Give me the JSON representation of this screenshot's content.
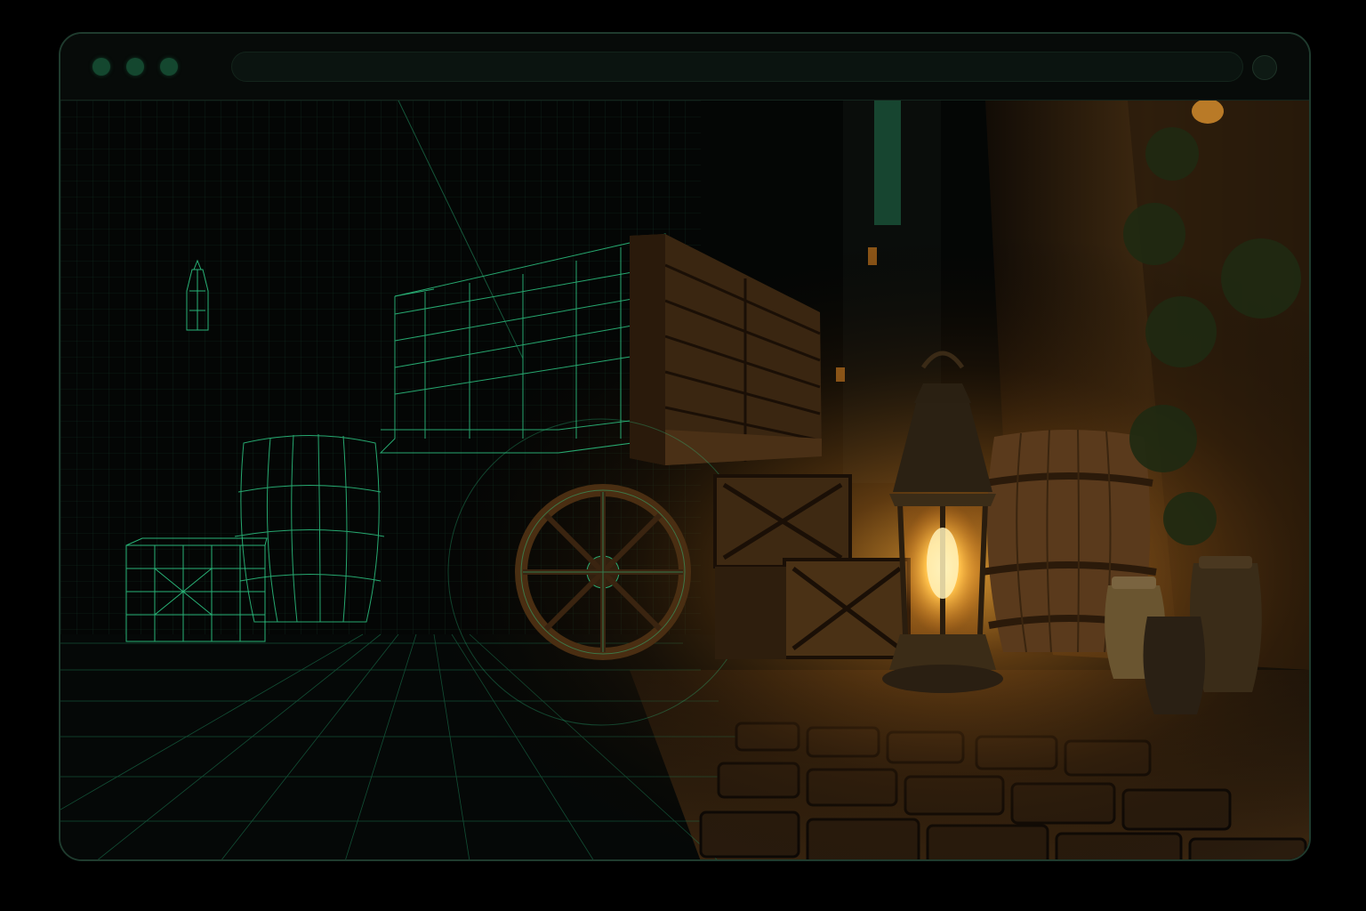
{
  "browser": {
    "address_text": "",
    "controls": [
      "close-dot",
      "minimize-dot",
      "maximize-dot"
    ]
  },
  "scene": {
    "description_colors": {
      "wire": "#2fd08a",
      "lantern_glow": "#ffb23a",
      "wood": "#5a3a1c",
      "dark": "#050807"
    }
  }
}
